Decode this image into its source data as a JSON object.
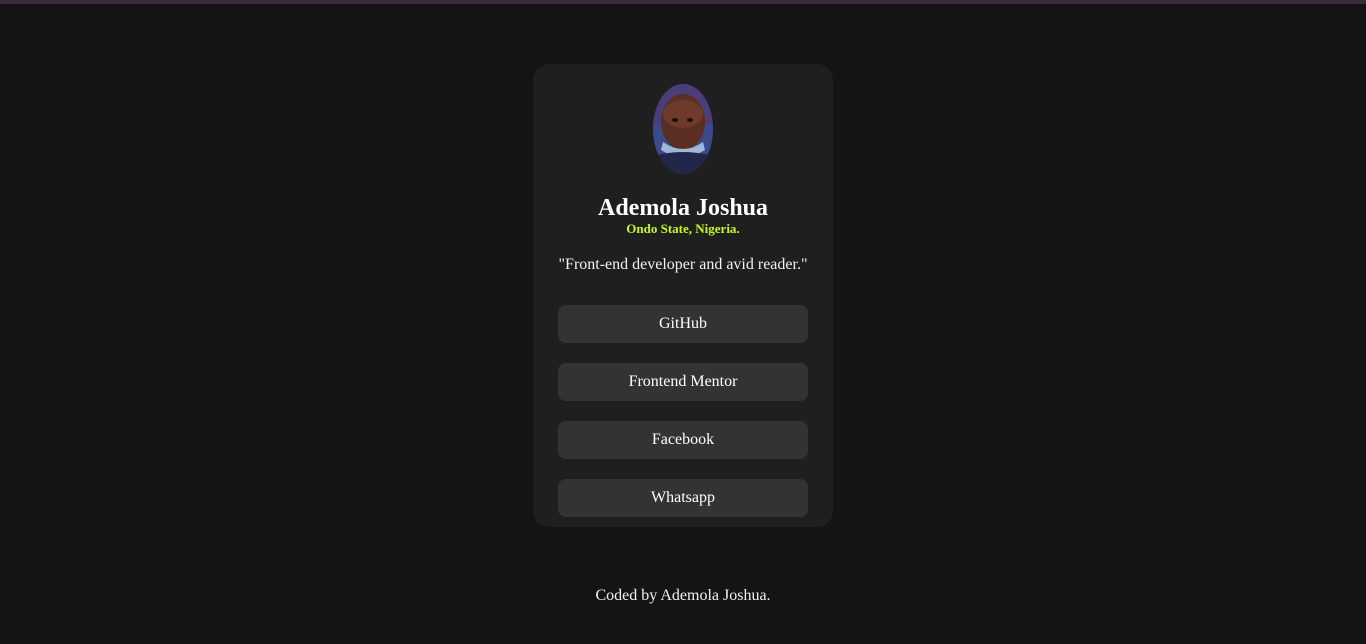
{
  "profile": {
    "name": "Ademola Joshua",
    "location": "Ondo State, Nigeria.",
    "bio": "\"Front-end developer and avid reader.\""
  },
  "links": [
    {
      "label": "GitHub",
      "icon": "github-link"
    },
    {
      "label": "Frontend Mentor",
      "icon": "frontend-mentor-link"
    },
    {
      "label": "Facebook",
      "icon": "facebook-link"
    },
    {
      "label": "Whatsapp",
      "icon": "whatsapp-link"
    }
  ],
  "footer": {
    "text": "Coded by Ademola Joshua."
  },
  "colors": {
    "background": "#141414",
    "card": "#1f1f1f",
    "button": "#333333",
    "accent": "#c5f82a"
  }
}
